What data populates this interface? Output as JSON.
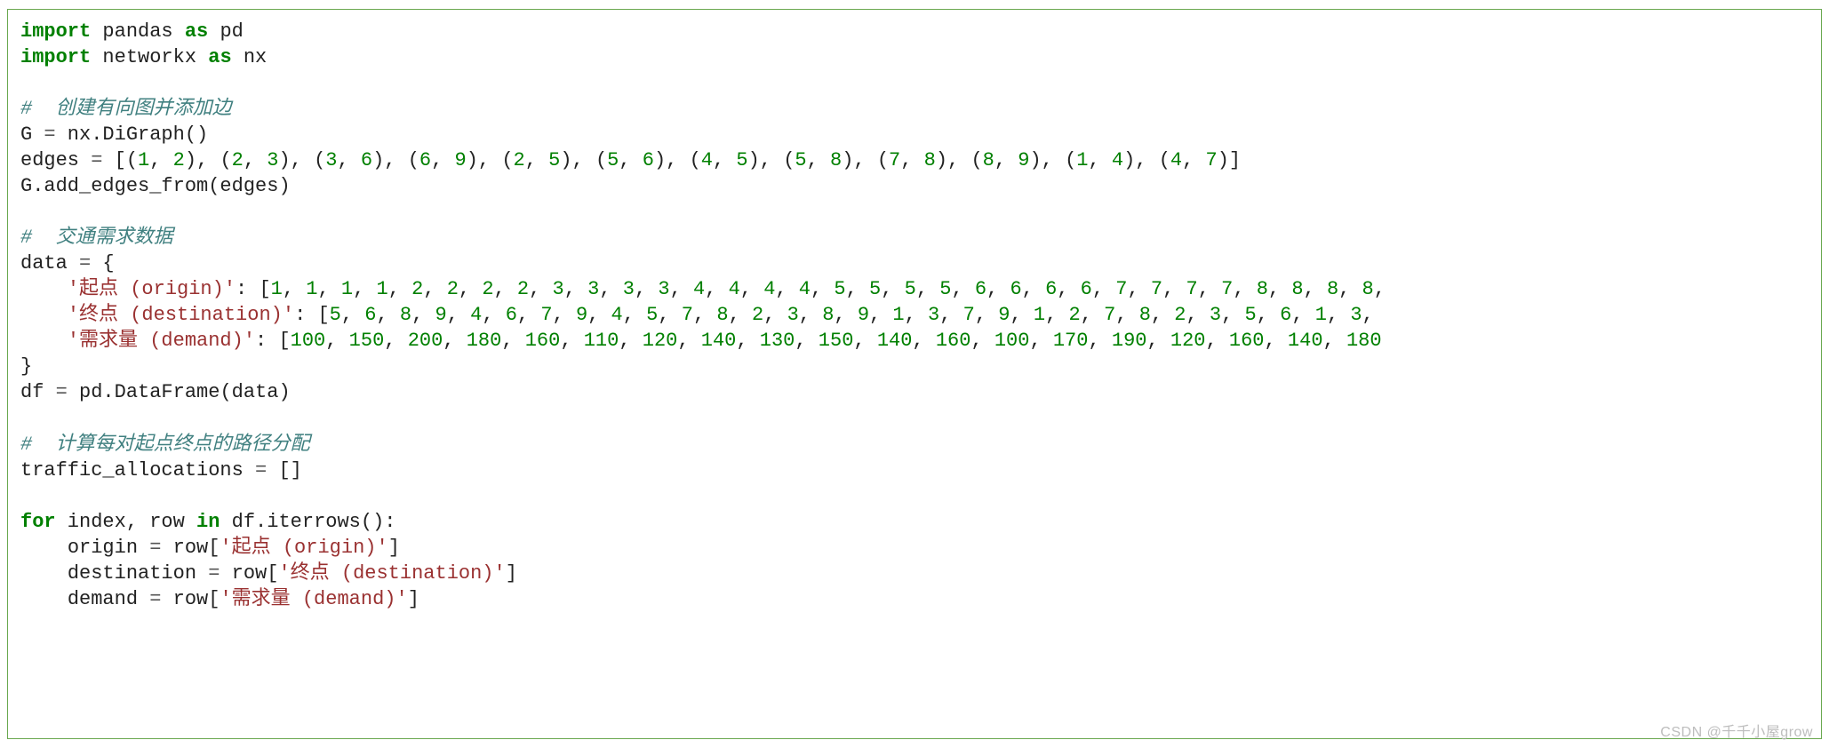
{
  "watermark": "CSDN @千千小屋grow",
  "code": {
    "l01": {
      "kw1": "import",
      "id1": " pandas ",
      "kw2": "as",
      "id2": " pd"
    },
    "l02": {
      "kw1": "import",
      "id1": " networkx ",
      "kw2": "as",
      "id2": " nx"
    },
    "cm1": "#  创建有向图并添加边",
    "l04": {
      "t1": "G ",
      "op": "=",
      "t2": " nx.DiGraph()"
    },
    "l05": {
      "t1": "edges ",
      "op": "=",
      "t2": " [(",
      "n1": "1",
      "c1": ", ",
      "n2": "2",
      "t3": "), (",
      "n3": "2",
      "c2": ", ",
      "n4": "3",
      "t4": "), (",
      "n5": "3",
      "c3": ", ",
      "n6": "6",
      "t5": "), (",
      "n7": "6",
      "c4": ", ",
      "n8": "9",
      "t6": "), (",
      "n9": "2",
      "c5": ", ",
      "n10": "5",
      "t7": "), (",
      "n11": "5",
      "c6": ", ",
      "n12": "6",
      "t8": "), (",
      "n13": "4",
      "c7": ", ",
      "n14": "5",
      "t9": "), (",
      "n15": "5",
      "c8": ", ",
      "n16": "8",
      "t10": "), (",
      "n17": "7",
      "c9": ", ",
      "n18": "8",
      "t11": "), (",
      "n19": "8",
      "c10": ", ",
      "n20": "9",
      "t12": "), (",
      "n21": "1",
      "c11": ", ",
      "n22": "4",
      "t13": "), (",
      "n23": "4",
      "c12": ", ",
      "n24": "7",
      "t14": ")]"
    },
    "l06": "G.add_edges_from(edges)",
    "cm2": "#  交通需求数据",
    "l08": {
      "t1": "data ",
      "op": "=",
      "t2": " {"
    },
    "l09": {
      "indent": "    ",
      "key": "'起点 (origin)'",
      "sep": ": [",
      "vals": [
        "1",
        "1",
        "1",
        "1",
        "2",
        "2",
        "2",
        "2",
        "3",
        "3",
        "3",
        "3",
        "4",
        "4",
        "4",
        "4",
        "5",
        "5",
        "5",
        "5",
        "6",
        "6",
        "6",
        "6",
        "7",
        "7",
        "7",
        "7",
        "8",
        "8",
        "8",
        "8"
      ],
      "tail": ","
    },
    "l10": {
      "indent": "    ",
      "key": "'终点 (destination)'",
      "sep": ": [",
      "vals": [
        "5",
        "6",
        "8",
        "9",
        "4",
        "6",
        "7",
        "9",
        "4",
        "5",
        "7",
        "8",
        "2",
        "3",
        "8",
        "9",
        "1",
        "3",
        "7",
        "9",
        "1",
        "2",
        "7",
        "8",
        "2",
        "3",
        "5",
        "6",
        "1",
        "3"
      ],
      "tail": ","
    },
    "l11": {
      "indent": "    ",
      "key": "'需求量 (demand)'",
      "sep": ": [",
      "vals": [
        "100",
        "150",
        "200",
        "180",
        "160",
        "110",
        "120",
        "140",
        "130",
        "150",
        "140",
        "160",
        "100",
        "170",
        "190",
        "120",
        "160",
        "140",
        "180"
      ],
      "tail": ""
    },
    "l12": "}",
    "l13": {
      "t1": "df ",
      "op": "=",
      "t2": " pd.DataFrame(data)"
    },
    "cm3": "#  计算每对起点终点的路径分配",
    "l15": {
      "t1": "traffic_allocations ",
      "op": "=",
      "t2": " []"
    },
    "l17": {
      "kw1": "for",
      "t1": " index, row ",
      "kw2": "in",
      "t2": " df.iterrows():"
    },
    "l18": {
      "indent": "    ",
      "t1": "origin ",
      "op": "=",
      "t2": " row[",
      "s": "'起点 (origin)'",
      "t3": "]"
    },
    "l19": {
      "indent": "    ",
      "t1": "destination ",
      "op": "=",
      "t2": " row[",
      "s": "'终点 (destination)'",
      "t3": "]"
    },
    "l20": {
      "indent": "    ",
      "t1": "demand ",
      "op": "=",
      "t2": " row[",
      "s": "'需求量 (demand)'",
      "t3": "]"
    }
  }
}
